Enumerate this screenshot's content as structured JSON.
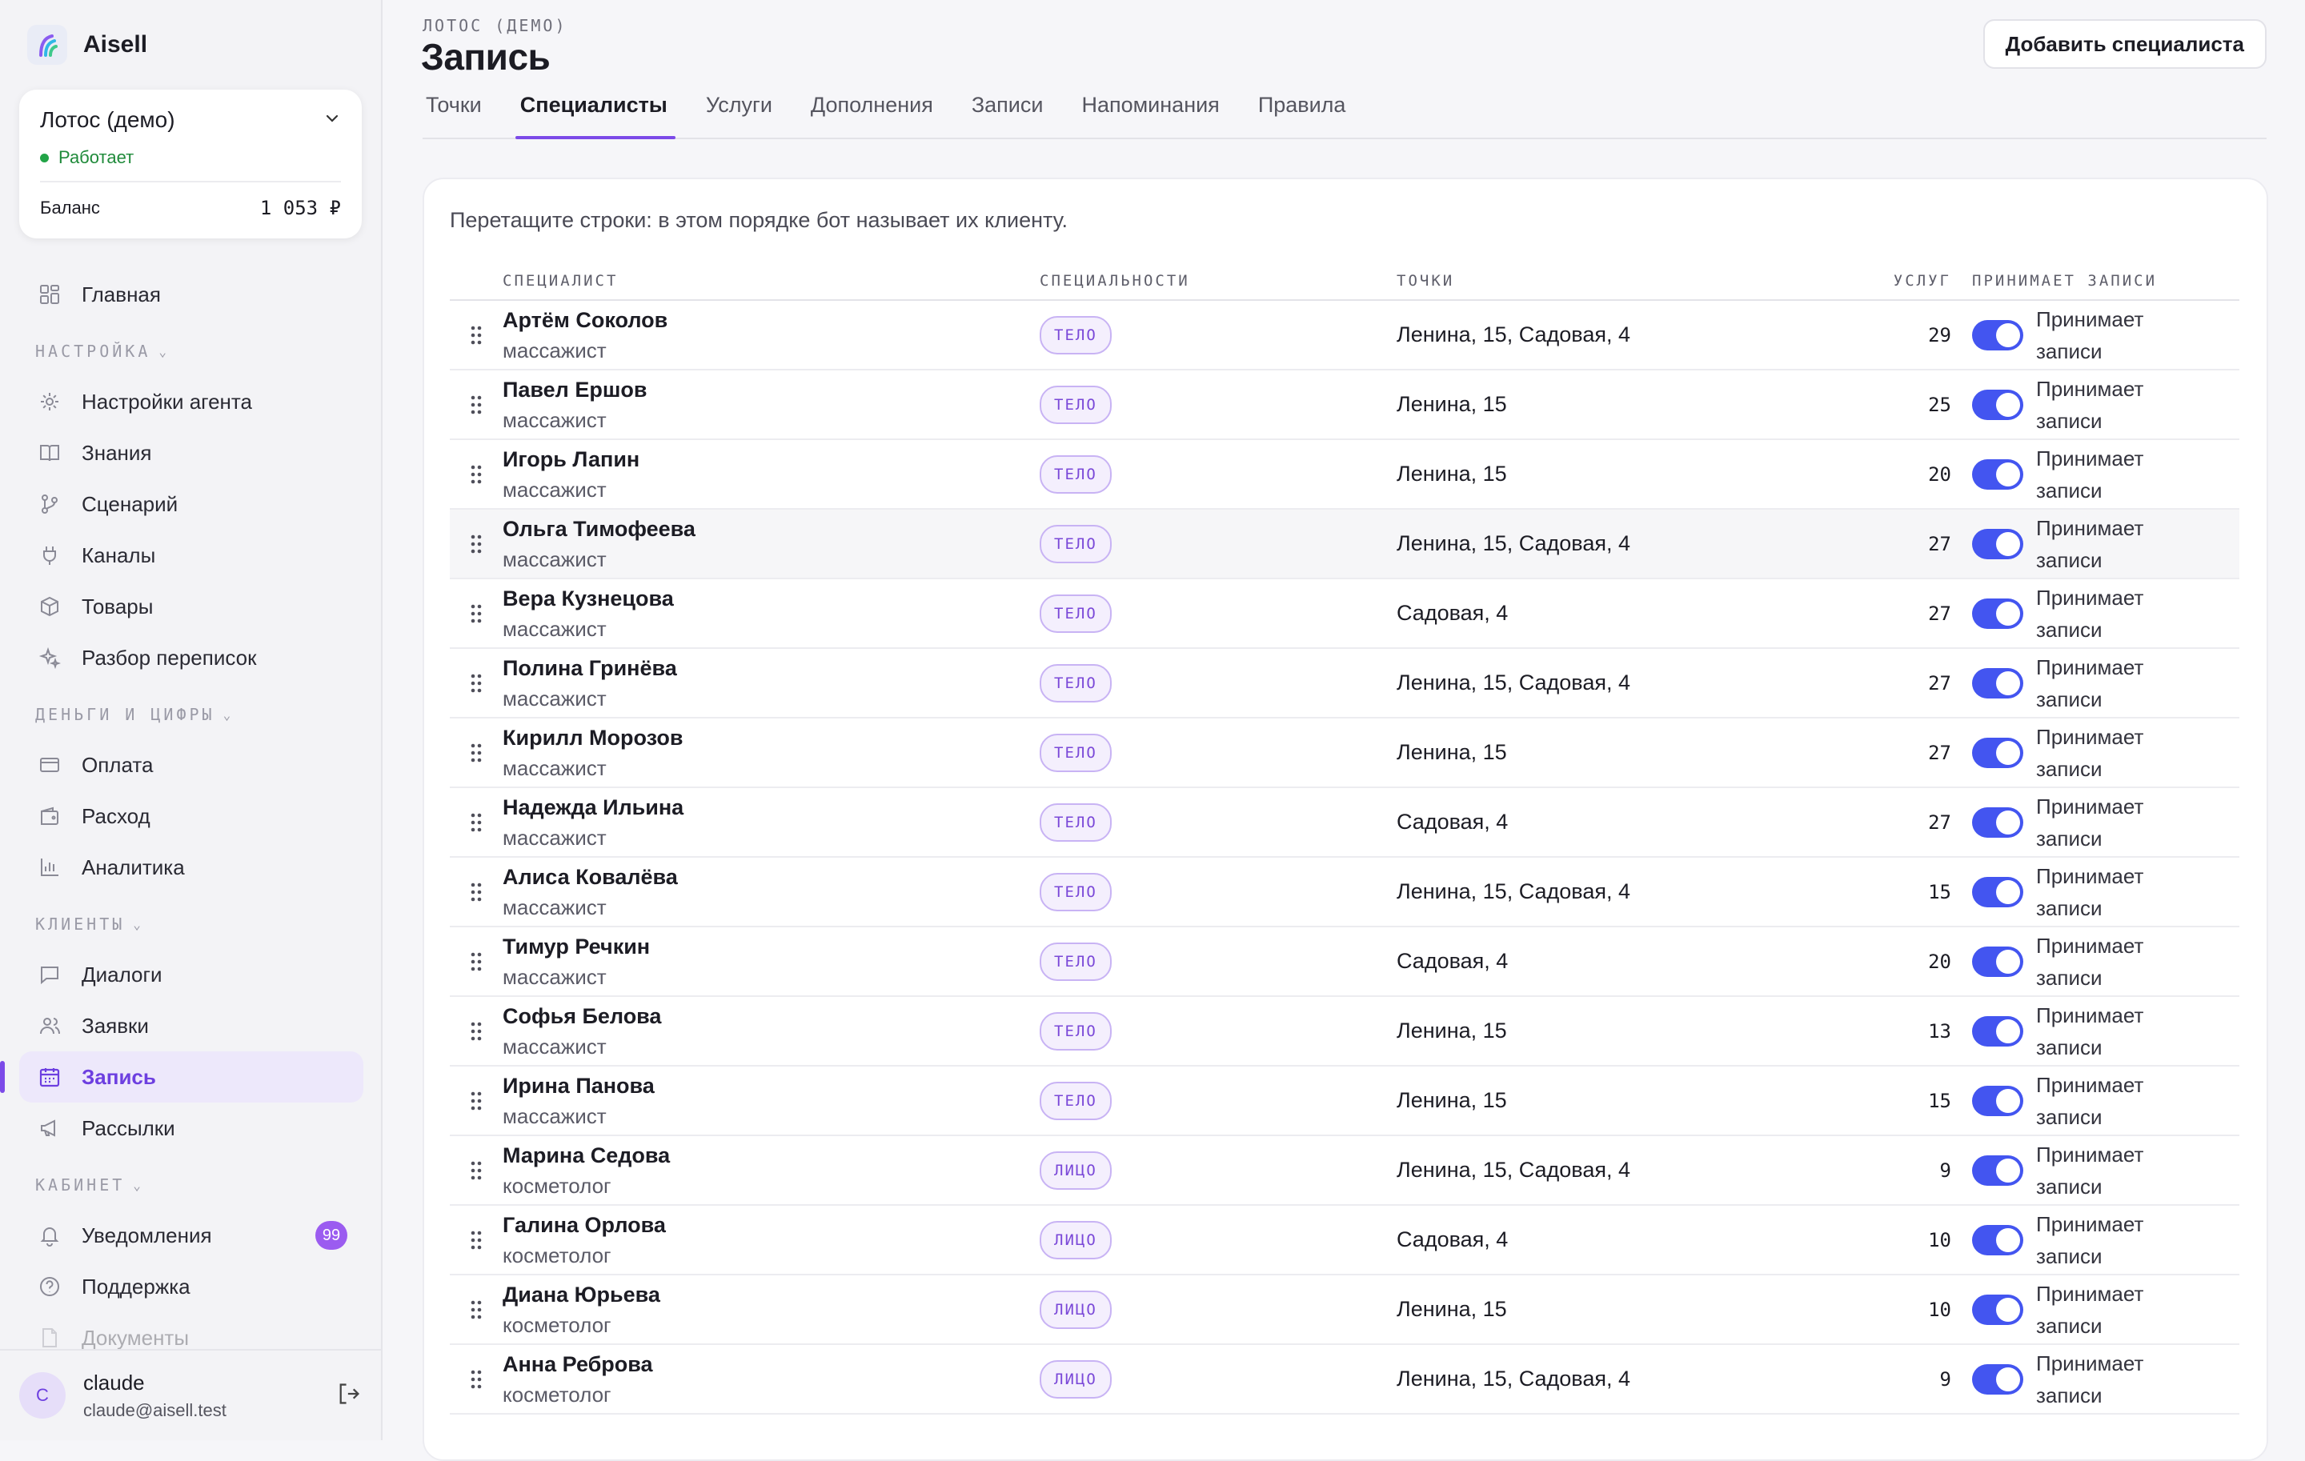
{
  "brand": {
    "name": "Aisell"
  },
  "org": {
    "name": "Лотос (демо)",
    "status": "Работает",
    "balance_label": "Баланс",
    "balance_value": "1 053 ₽"
  },
  "nav": {
    "home": "Главная",
    "section_settings": "НАСТРОЙКА",
    "agent_settings": "Настройки агента",
    "knowledge": "Знания",
    "scenario": "Сценарий",
    "channels": "Каналы",
    "products": "Товары",
    "chat_review": "Разбор переписок",
    "section_money": "ДЕНЬГИ И ЦИФРЫ",
    "payment": "Оплата",
    "expense": "Расход",
    "analytics": "Аналитика",
    "section_clients": "КЛИЕНТЫ",
    "dialogs": "Диалоги",
    "requests": "Заявки",
    "booking": "Запись",
    "mailings": "Рассылки",
    "section_cabinet": "КАБИНЕТ",
    "notifications": "Уведомления",
    "notifications_badge": "99",
    "support": "Поддержка",
    "documents": "Документы"
  },
  "user": {
    "initial": "C",
    "name": "claude",
    "email": "claude@aisell.test"
  },
  "header": {
    "eyebrow": "ЛОТОС (ДЕМО)",
    "title": "Запись",
    "add_button": "Добавить специалиста",
    "tabs": [
      "Точки",
      "Специалисты",
      "Услуги",
      "Дополнения",
      "Записи",
      "Напоминания",
      "Правила"
    ],
    "active_tab": "Специалисты"
  },
  "hint": "Перетащите строки: в этом порядке бот называет их клиенту.",
  "table": {
    "headers": {
      "specialist": "СПЕЦИАЛИСТ",
      "specialties": "СПЕЦИАЛЬНОСТИ",
      "points": "ТОЧКИ",
      "services": "УСЛУГ",
      "accepts": "ПРИНИМАЕТ ЗАПИСИ"
    },
    "accept_label_line1": "Принимает",
    "accept_label_line2": "записи",
    "rows": [
      {
        "name": "Артём Соколов",
        "role": "массажист",
        "specialty": "ТЕЛО",
        "points": "Ленина, 15, Садовая, 4",
        "services": "29",
        "accepts": true
      },
      {
        "name": "Павел Ершов",
        "role": "массажист",
        "specialty": "ТЕЛО",
        "points": "Ленина, 15",
        "services": "25",
        "accepts": true
      },
      {
        "name": "Игорь Лапин",
        "role": "массажист",
        "specialty": "ТЕЛО",
        "points": "Ленина, 15",
        "services": "20",
        "accepts": true
      },
      {
        "name": "Ольга Тимофеева",
        "role": "массажист",
        "specialty": "ТЕЛО",
        "points": "Ленина, 15, Садовая, 4",
        "services": "27",
        "accepts": true
      },
      {
        "name": "Вера Кузнецова",
        "role": "массажист",
        "specialty": "ТЕЛО",
        "points": "Садовая, 4",
        "services": "27",
        "accepts": true
      },
      {
        "name": "Полина Гринёва",
        "role": "массажист",
        "specialty": "ТЕЛО",
        "points": "Ленина, 15, Садовая, 4",
        "services": "27",
        "accepts": true
      },
      {
        "name": "Кирилл Морозов",
        "role": "массажист",
        "specialty": "ТЕЛО",
        "points": "Ленина, 15",
        "services": "27",
        "accepts": true
      },
      {
        "name": "Надежда Ильина",
        "role": "массажист",
        "specialty": "ТЕЛО",
        "points": "Садовая, 4",
        "services": "27",
        "accepts": true
      },
      {
        "name": "Алиса Ковалёва",
        "role": "массажист",
        "specialty": "ТЕЛО",
        "points": "Ленина, 15, Садовая, 4",
        "services": "15",
        "accepts": true
      },
      {
        "name": "Тимур Речкин",
        "role": "массажист",
        "specialty": "ТЕЛО",
        "points": "Садовая, 4",
        "services": "20",
        "accepts": true
      },
      {
        "name": "Софья Белова",
        "role": "массажист",
        "specialty": "ТЕЛО",
        "points": "Ленина, 15",
        "services": "13",
        "accepts": true
      },
      {
        "name": "Ирина Панова",
        "role": "массажист",
        "specialty": "ТЕЛО",
        "points": "Ленина, 15",
        "services": "15",
        "accepts": true
      },
      {
        "name": "Марина Седова",
        "role": "косметолог",
        "specialty": "ЛИЦО",
        "points": "Ленина, 15, Садовая, 4",
        "services": "9",
        "accepts": true
      },
      {
        "name": "Галина Орлова",
        "role": "косметолог",
        "specialty": "ЛИЦО",
        "points": "Садовая, 4",
        "services": "10",
        "accepts": true
      },
      {
        "name": "Диана Юрьева",
        "role": "косметолог",
        "specialty": "ЛИЦО",
        "points": "Ленина, 15",
        "services": "10",
        "accepts": true
      },
      {
        "name": "Анна Реброва",
        "role": "косметолог",
        "specialty": "ЛИЦО",
        "points": "Ленина, 15, Садовая, 4",
        "services": "9",
        "accepts": true
      }
    ]
  },
  "colors": {
    "accent": "#7c4ae8",
    "toggle_on": "#4355f0",
    "status_green": "#22a447"
  }
}
